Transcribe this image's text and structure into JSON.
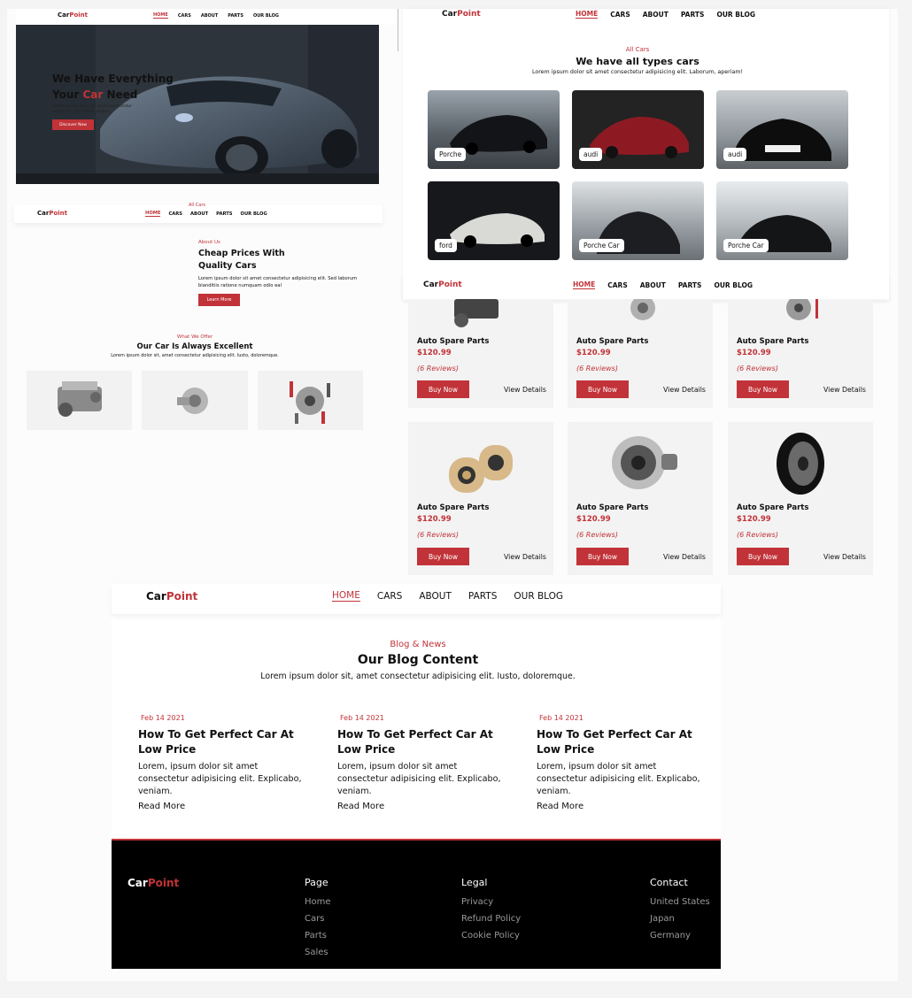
{
  "brand": {
    "car": "Car",
    "point": "Point"
  },
  "nav": [
    "HOME",
    "CARS",
    "ABOUT",
    "PARTS",
    "OUR BLOG"
  ],
  "hero": {
    "title_line1": "We Have Everything",
    "title_line2_a": "Your ",
    "title_line2_b": "Car",
    "title_line2_c": " Need",
    "text": "Lorem ipsum dolor sit amet consectetur adipisicing elit. Nulla, neque.",
    "button": "Discover Now"
  },
  "about": {
    "small_label": "All Cars",
    "tag": "About Us",
    "title_line1": "Cheap Prices With",
    "title_line2": "Quality Cars",
    "text": "Lorem ipsum dolor sit amet consectetur adipisicing elit. Sed laborum blanditiis ratione numquam odio eal",
    "button": "Learn More"
  },
  "offer": {
    "tag": "What We Offer",
    "title": "Our Car Is Always Excellent",
    "subtitle": "Lorem ipsum dolor sit, amet consectetur adipisicing elit. Iusto, doloremque."
  },
  "cars": {
    "tag": "All Cars",
    "title": "We have all types cars",
    "subtitle": "Lorem ipsum dolor sit amet consectetur adipisicing elit. Laborum, aperiam!",
    "items": [
      "Porche",
      "audi",
      "audi",
      "ford",
      "Porche Car",
      "Porche Car"
    ]
  },
  "parts": {
    "name": "Auto Spare Parts",
    "price": "$120.99",
    "reviews": "(6 Reviews)",
    "buy": "Buy Now",
    "details": "View Details",
    "row1_icons": [
      "engine-icon",
      "turbo-icon",
      "brake-kit-icon"
    ],
    "row2_icons": [
      "oil-filter-icon",
      "alternator-icon",
      "tire-icon"
    ]
  },
  "blog": {
    "tag": "Blog & News",
    "title": "Our Blog Content",
    "subtitle": "Lorem ipsum dolor sit, amet consectetur adipisicing elit. Iusto, doloremque.",
    "posts": [
      {
        "date": "Feb 14 2021",
        "title": "How To Get Perfect Car At Low Price",
        "text": "Lorem, ipsum dolor sit amet consectetur adipisicing elit. Explicabo, veniam.",
        "more": "Read More"
      },
      {
        "date": "Feb 14 2021",
        "title": "How To Get Perfect Car At Low Price",
        "text": "Lorem, ipsum dolor sit amet consectetur adipisicing elit. Explicabo, veniam.",
        "more": "Read More"
      },
      {
        "date": "Feb 14 2021",
        "title": "How To Get Perfect Car At Low Price",
        "text": "Lorem, ipsum dolor sit amet consectetur adipisicing elit. Explicabo, veniam.",
        "more": "Read More"
      }
    ]
  },
  "footer": {
    "page": {
      "heading": "Page",
      "links": [
        "Home",
        "Cars",
        "Parts",
        "Sales"
      ]
    },
    "legal": {
      "heading": "Legal",
      "links": [
        "Privacy",
        "Refund Policy",
        "Cookie Policy"
      ]
    },
    "contact": {
      "heading": "Contact",
      "links": [
        "United States",
        "Japan",
        "Germany"
      ]
    }
  },
  "colors": {
    "accent": "#c13338",
    "dark": "#000000",
    "card": "#f3f3f3"
  }
}
